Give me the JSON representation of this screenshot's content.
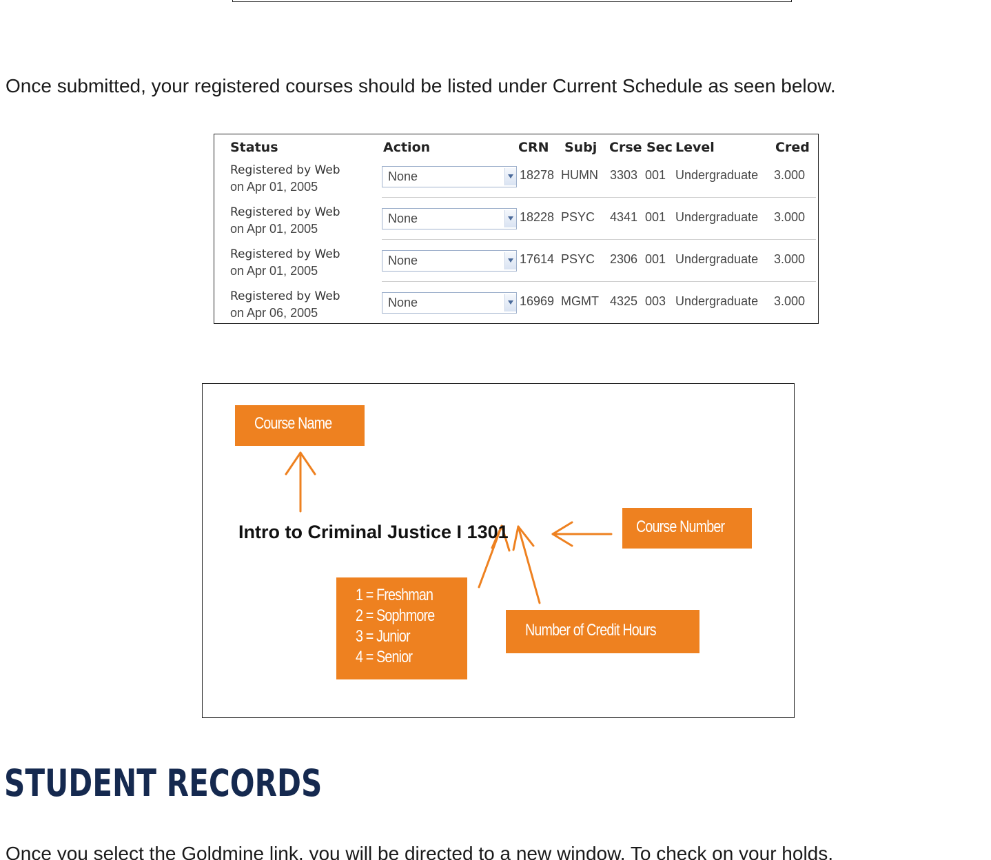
{
  "intro": "Once submitted, your registered courses should be listed under Current Schedule as seen below.",
  "schedule": {
    "headers": {
      "status": "Status",
      "action": "Action",
      "crn": "CRN",
      "subj": "Subj",
      "crse": "Crse",
      "sec": "Sec",
      "level": "Level",
      "cred": "Cred"
    },
    "rows": [
      {
        "status": "Registered by Web",
        "date": "on Apr 01, 2005",
        "action": "None",
        "crn": "18278",
        "subj": "HUMN",
        "crse": "3303",
        "sec": "001",
        "level": "Undergraduate",
        "cred": "3.000"
      },
      {
        "status": "Registered by Web",
        "date": "on Apr 01, 2005",
        "action": "None",
        "crn": "18228",
        "subj": "PSYC",
        "crse": "4341",
        "sec": "001",
        "level": "Undergraduate",
        "cred": "3.000"
      },
      {
        "status": "Registered by Web",
        "date": "on Apr 01, 2005",
        "action": "None",
        "crn": "17614",
        "subj": "PSYC",
        "crse": "2306",
        "sec": "001",
        "level": "Undergraduate",
        "cred": "3.000"
      },
      {
        "status": "Registered by Web",
        "date": "on Apr 06, 2005",
        "action": "None",
        "crn": "16969",
        "subj": "MGMT",
        "crse": "4325",
        "sec": "003",
        "level": "Undergraduate",
        "cred": "3.000"
      }
    ]
  },
  "diagram": {
    "course_title": "Intro to Criminal Justice I 1301",
    "course_name_label": "Course Name",
    "course_number_label": "Course Number",
    "credit_hours_label": "Number of Credit Hours",
    "levels": [
      "1 = Freshman",
      "2 = Sophmore",
      "3 = Junior",
      "4 = Senior"
    ],
    "accent_color": "#ee8120"
  },
  "section_heading": "STUDENT RECORDS",
  "bottom_text": "Once you select the Goldmine link, you will be directed to a new window. To check on your holds,"
}
